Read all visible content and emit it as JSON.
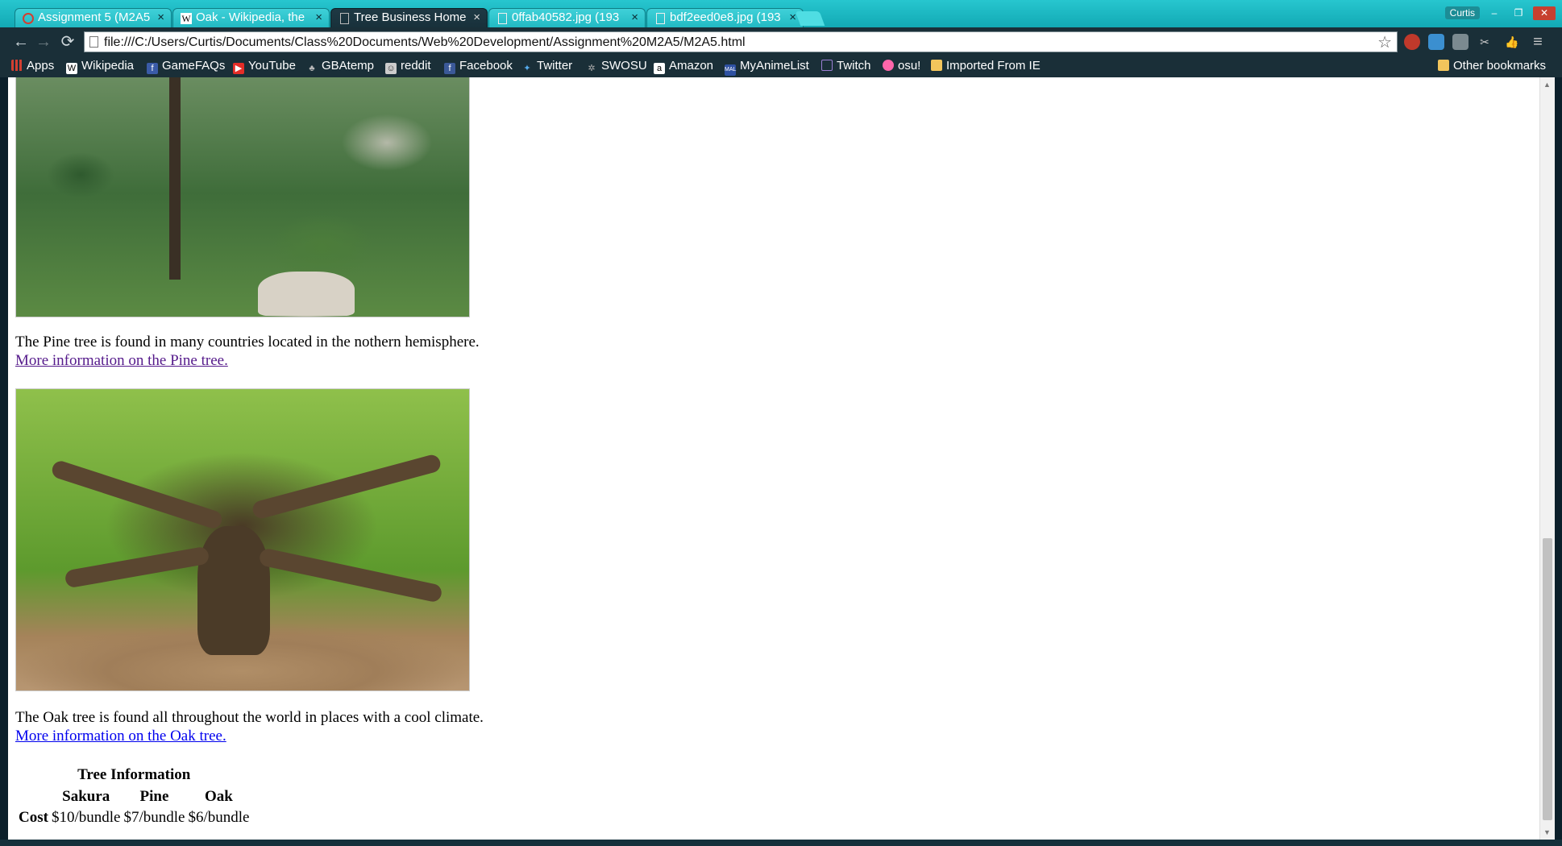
{
  "browser": {
    "tabs": [
      {
        "title": "Assignment 5 (M2A5",
        "favicon": "loading-icon",
        "active": false
      },
      {
        "title": "Oak - Wikipedia, the",
        "favicon": "wikipedia-icon",
        "active": false
      },
      {
        "title": "Tree Business Home",
        "favicon": "page-icon",
        "active": true
      },
      {
        "title": "0ffab40582.jpg (193",
        "favicon": "page-icon",
        "active": false
      },
      {
        "title": "bdf2eed0e8.jpg (193",
        "favicon": "page-icon",
        "active": false
      }
    ],
    "tab_close": "×",
    "user": "Curtis",
    "window_buttons": {
      "minimize": "–",
      "restore": "❐",
      "close": "✕"
    },
    "address": "file:///C:/Users/Curtis/Documents/Class%20Documents/Web%20Development/Assignment%20M2A5/M2A5.html",
    "nav": {
      "back": "←",
      "forward": "→",
      "reload": "⟳",
      "star": "☆",
      "menu": "≡"
    },
    "bookmarks": [
      {
        "label": "Apps",
        "icon": "apps-grid-icon",
        "color": "#d23f31"
      },
      {
        "label": "Wikipedia",
        "icon": "wikipedia-icon",
        "color": "#ffffff"
      },
      {
        "label": "GameFAQs",
        "icon": "gamefaqs-icon",
        "color": "#3a5ba8"
      },
      {
        "label": "YouTube",
        "icon": "youtube-icon",
        "color": "#e52d27"
      },
      {
        "label": "GBAtemp",
        "icon": "gbatemp-icon",
        "color": "#bbbbbb"
      },
      {
        "label": "reddit",
        "icon": "reddit-icon",
        "color": "#cccccc"
      },
      {
        "label": "Facebook",
        "icon": "facebook-icon",
        "color": "#3b5998"
      },
      {
        "label": "Twitter",
        "icon": "twitter-icon",
        "color": "#55acee"
      },
      {
        "label": "SWOSU",
        "icon": "gear-icon",
        "color": "#aaaaaa"
      },
      {
        "label": "Amazon",
        "icon": "amazon-icon",
        "color": "#ffffff"
      },
      {
        "label": "MyAnimeList",
        "icon": "myanimelist-icon",
        "color": "#2e51a2"
      },
      {
        "label": "Twitch",
        "icon": "twitch-icon",
        "color": "#6441a5"
      },
      {
        "label": "osu!",
        "icon": "osu-icon",
        "color": "#ff66aa"
      },
      {
        "label": "Imported From IE",
        "icon": "folder-icon",
        "color": "#f2c55c"
      }
    ],
    "other_bookmarks": "Other bookmarks"
  },
  "page": {
    "pine": {
      "description": "The Pine tree is found in many countries located in the nothern hemisphere.",
      "link": "More information on the Pine tree.",
      "image": "pine-tree-photo"
    },
    "oak": {
      "description": "The Oak tree is found all throughout the world in places with a cool climate.",
      "link": "More information on the Oak tree.",
      "image": "oak-tree-photo"
    },
    "table": {
      "caption": "Tree Information",
      "columns": [
        "Sakura",
        "Pine",
        "Oak"
      ],
      "row_label": "Cost",
      "values": [
        "$10/bundle",
        "$7/bundle",
        "$6/bundle"
      ]
    }
  },
  "colors": {
    "tab_strip": "#1fb9c3",
    "toolbar": "#1a2f38",
    "visited_link": "#551a8b",
    "unvisited_link": "#0000ee"
  }
}
